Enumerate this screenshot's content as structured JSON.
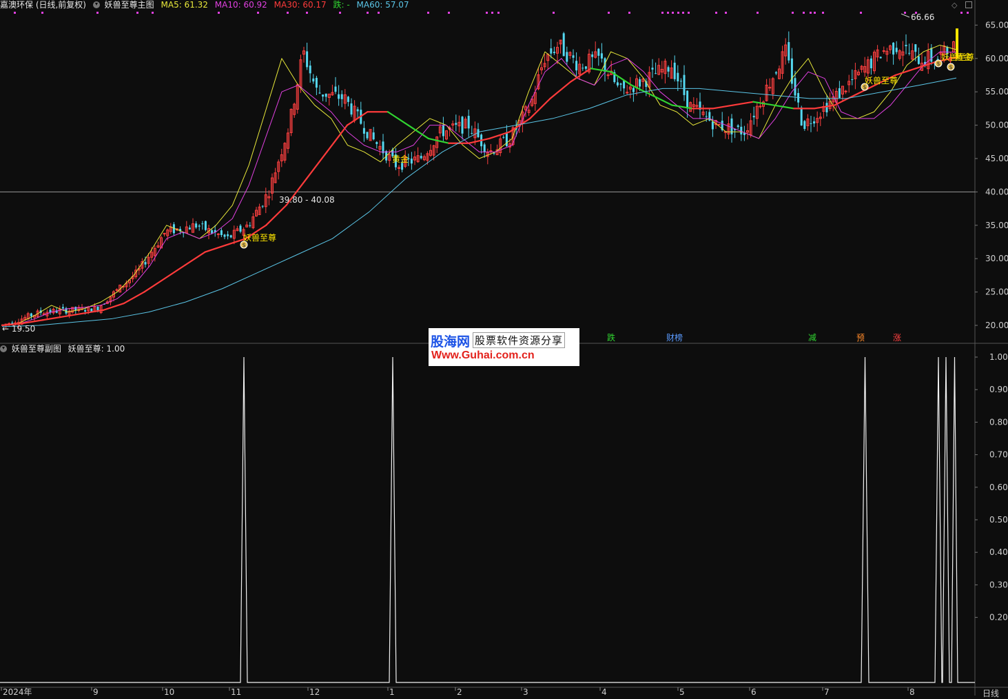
{
  "header": {
    "stock": "嘉澳环保 (日线,前复权)",
    "indicator": "妖兽至尊主图",
    "ma5": "MA5: 61.32",
    "ma10": "MA10: 60.92",
    "ma30": "MA30: 60.17",
    "die": "跌: -",
    "ma60": "MA60: 57.07"
  },
  "sub_header": {
    "indicator": "妖兽至尊副图",
    "value": "妖兽至尊: 1.00"
  },
  "colors": {
    "ma5": "#e8e83a",
    "ma10": "#e040e0",
    "ma30": "#ff3b3b",
    "die": "#31d431",
    "ma60": "#5bc6e8",
    "up": "#ff4040",
    "down": "#55d8f0"
  },
  "price_axis": [
    "65.00",
    "60.00",
    "55.00",
    "50.00",
    "45.00",
    "40.00",
    "35.00",
    "30.00",
    "25.00",
    "20.00"
  ],
  "sub_axis": [
    "1.00",
    "0.90",
    "0.80",
    "0.70",
    "0.60",
    "0.50",
    "0.40",
    "0.30",
    "0.20"
  ],
  "time_axis": [
    "2024年",
    "9",
    "10",
    "11",
    "12",
    "1",
    "2",
    "3",
    "4",
    "5",
    "6",
    "7",
    "8"
  ],
  "annotations": {
    "high": "66.66",
    "low": "19.50",
    "range": "39.80 - 40.08",
    "sig1": "妖兽至尊",
    "sig2": "妖兽至尊",
    "gold": "黄金",
    "gold2": "黄金",
    "sig3": "妖兽至尊"
  },
  "events": [
    {
      "label": "跌",
      "color": "#31d431"
    },
    {
      "label": "财榜",
      "color": "#5b9bff"
    },
    {
      "label": "减",
      "color": "#31d431"
    },
    {
      "label": "预",
      "color": "#ff8a2a"
    },
    {
      "label": "涨",
      "color": "#ff4040"
    }
  ],
  "watermark": {
    "brand": "股海网",
    "tagline": "股票软件资源分享",
    "url": "Www.Guhai.com.cn"
  },
  "period_label": "日线",
  "chart_data": [
    {
      "type": "candlestick",
      "title": "妖兽至尊主图",
      "ylim": [
        19,
        67
      ],
      "high": 66.66,
      "low": 19.5,
      "series": [
        {
          "name": "MA5",
          "values": [
            20,
            20.3,
            21.5,
            23,
            22,
            22.5,
            23.5,
            25,
            27.5,
            31,
            35,
            34,
            33,
            35,
            38,
            44,
            52,
            60,
            56,
            53,
            51,
            47,
            46,
            44.5,
            47,
            49,
            51,
            50,
            47,
            45,
            46,
            48,
            55,
            61,
            59,
            57,
            56,
            61,
            60,
            57,
            53,
            52,
            50,
            51,
            49,
            49,
            48,
            53,
            57,
            60,
            55,
            51,
            51,
            52,
            55,
            59,
            61,
            62,
            61.32
          ]
        },
        {
          "name": "MA10",
          "values": [
            20,
            20.2,
            21,
            22,
            22.5,
            22.7,
            23,
            24,
            26,
            29,
            33,
            34,
            33,
            34,
            36,
            41,
            48,
            55,
            56,
            54,
            52,
            49,
            47,
            46,
            46,
            47,
            50,
            50,
            48,
            46,
            46,
            47,
            53,
            58,
            60,
            57,
            56,
            59,
            60,
            58,
            55,
            53,
            51,
            51,
            50,
            49,
            48,
            51,
            55,
            58,
            57,
            52,
            51,
            51,
            53,
            56,
            59,
            61,
            60.92
          ]
        },
        {
          "name": "MA30",
          "values": [
            20,
            20.3,
            20.8,
            21.3,
            21.8,
            22.3,
            23.3,
            25,
            27,
            29,
            31,
            32,
            33,
            35,
            38,
            42,
            46,
            50,
            52,
            52,
            50,
            48,
            47.3,
            47.3,
            48,
            49,
            51,
            54,
            56.5,
            58.5,
            58,
            56,
            54.5,
            53,
            52.5,
            52.5,
            53,
            53.5,
            53,
            52.5,
            52.5,
            53,
            54.5,
            56,
            57.5,
            58.5,
            59.5,
            60.17
          ]
        },
        {
          "name": "MA60",
          "values": [
            19.8,
            20,
            20.5,
            21,
            22,
            23.5,
            25.5,
            28,
            30.5,
            33,
            37,
            42,
            46,
            49,
            50,
            51,
            52.5,
            54.5,
            55.5,
            55.5,
            55,
            54.5,
            54,
            54,
            55,
            56,
            57.07
          ]
        }
      ]
    },
    {
      "type": "line",
      "title": "妖兽至尊副图",
      "series": [
        {
          "name": "妖兽至尊",
          "signal_dates_on_time_axis": [
            "11",
            "1",
            "7/8",
            "8",
            "8",
            "8"
          ],
          "peak_value": 1.0,
          "base_value": 0.0
        }
      ],
      "ylim": [
        0,
        1.0
      ]
    }
  ]
}
